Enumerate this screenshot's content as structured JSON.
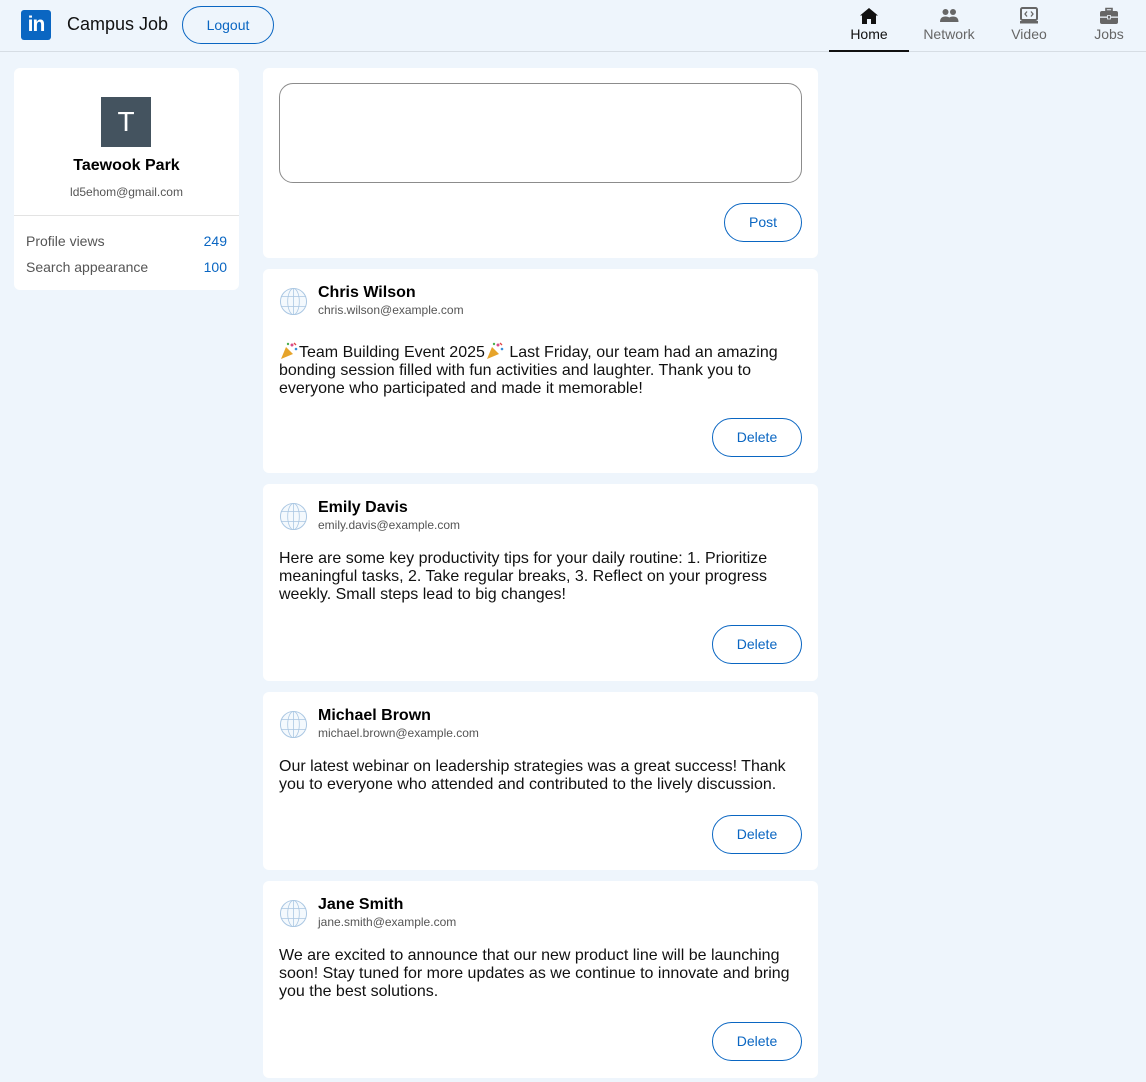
{
  "header": {
    "logo_text": "in",
    "app_title": "Campus Job",
    "logout_label": "Logout",
    "nav": [
      {
        "label": "Home",
        "icon": "home-icon",
        "active": true
      },
      {
        "label": "Network",
        "icon": "network-icon",
        "active": false
      },
      {
        "label": "Video",
        "icon": "video-icon",
        "active": false
      },
      {
        "label": "Jobs",
        "icon": "jobs-icon",
        "active": false
      }
    ]
  },
  "profile": {
    "avatar_initial": "T",
    "name": "Taewook Park",
    "email": "ld5ehom@gmail.com",
    "stats": [
      {
        "label": "Profile views",
        "value": "249"
      },
      {
        "label": "Search appearance",
        "value": "100"
      }
    ]
  },
  "compose": {
    "placeholder": "",
    "post_label": "Post"
  },
  "posts": [
    {
      "name": "Chris Wilson",
      "email": "chris.wilson@example.com",
      "body": "Team Building Event 2025",
      "body_rest": " Last Friday, our team had an amazing bonding session filled with fun activities and laughter. Thank you to everyone who participated and made it memorable!",
      "delete_label": "Delete"
    },
    {
      "name": "Emily Davis",
      "email": "emily.davis@example.com",
      "body": "Here are some key productivity tips for your daily routine: 1. Prioritize meaningful tasks, 2. Take regular breaks, 3. Reflect on your progress weekly. Small steps lead to big changes!",
      "delete_label": "Delete"
    },
    {
      "name": "Michael Brown",
      "email": "michael.brown@example.com",
      "body": "Our latest webinar on leadership strategies was a great success! Thank you to everyone who attended and contributed to the lively discussion.",
      "delete_label": "Delete"
    },
    {
      "name": "Jane Smith",
      "email": "jane.smith@example.com",
      "body": "We are excited to announce that our new product line will be launching soon! Stay tuned for more updates as we continue to innovate and bring you the best solutions.",
      "delete_label": "Delete"
    }
  ],
  "colors": {
    "brand": "#0a66c2",
    "background": "#eef5fc",
    "avatar_bg": "#44535f"
  }
}
